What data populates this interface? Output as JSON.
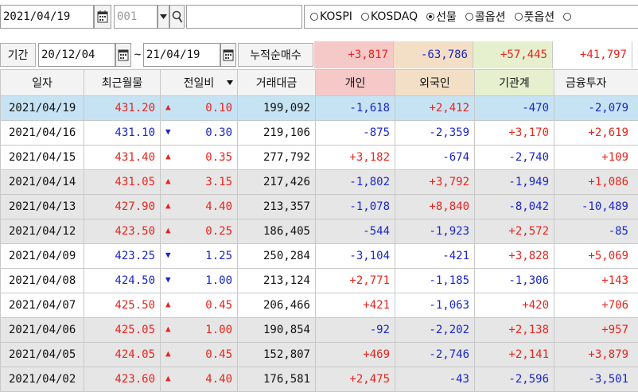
{
  "toolbar": {
    "date": "2021/04/19",
    "code": "001",
    "search_value": "",
    "markets": [
      {
        "label": "KOSPI",
        "selected": false
      },
      {
        "label": "KOSDAQ",
        "selected": false
      },
      {
        "label": "선물",
        "selected": true
      },
      {
        "label": "콜옵션",
        "selected": false
      },
      {
        "label": "풋옵션",
        "selected": false
      },
      {
        "label": "",
        "selected": false
      }
    ]
  },
  "period": {
    "label": "기간",
    "start": "20/12/04",
    "separator": "~",
    "end": "21/04/19",
    "cumulative_label": "누적순매수"
  },
  "summary": [
    "+3,817",
    "-63,786",
    "+57,445",
    "+41,797"
  ],
  "colors": {
    "up": "#e8241c",
    "down": "#1a26c8",
    "header_individual": "#f6c9c9",
    "header_foreign": "#f3dfc6",
    "header_institution": "#e6f0cf",
    "selected_row": "#c6e3f3",
    "shaded_row": "#e6e6e6"
  },
  "table": {
    "columns": [
      "일자",
      "최근월물",
      "전일비",
      "거래대금",
      "개인",
      "외국인",
      "기관계",
      "금융투자"
    ],
    "rows": [
      {
        "date": "2021/04/19",
        "price": "431.20",
        "dir": "up",
        "change": "0.10",
        "amount": "199,092",
        "individual": "-1,618",
        "foreign": "+2,412",
        "institution": "-470",
        "financial": "-2,079",
        "shade": "selected"
      },
      {
        "date": "2021/04/16",
        "price": "431.10",
        "dir": "down",
        "change": "0.30",
        "amount": "219,106",
        "individual": "-875",
        "foreign": "-2,359",
        "institution": "+3,170",
        "financial": "+2,619",
        "shade": "white"
      },
      {
        "date": "2021/04/15",
        "price": "431.40",
        "dir": "up",
        "change": "0.35",
        "amount": "277,792",
        "individual": "+3,182",
        "foreign": "-674",
        "institution": "-2,740",
        "financial": "+109",
        "shade": "white"
      },
      {
        "date": "2021/04/14",
        "price": "431.05",
        "dir": "up",
        "change": "3.15",
        "amount": "217,426",
        "individual": "-1,802",
        "foreign": "+3,792",
        "institution": "-1,949",
        "financial": "+1,086",
        "shade": "grey"
      },
      {
        "date": "2021/04/13",
        "price": "427.90",
        "dir": "up",
        "change": "4.40",
        "amount": "213,357",
        "individual": "-1,078",
        "foreign": "+8,840",
        "institution": "-8,042",
        "financial": "-10,489",
        "shade": "grey"
      },
      {
        "date": "2021/04/12",
        "price": "423.50",
        "dir": "up",
        "change": "0.25",
        "amount": "186,405",
        "individual": "-544",
        "foreign": "-1,923",
        "institution": "+2,572",
        "financial": "-85",
        "shade": "grey"
      },
      {
        "date": "2021/04/09",
        "price": "423.25",
        "dir": "down",
        "change": "1.25",
        "amount": "250,284",
        "individual": "-3,104",
        "foreign": "-421",
        "institution": "+3,828",
        "financial": "+5,069",
        "shade": "white"
      },
      {
        "date": "2021/04/08",
        "price": "424.50",
        "dir": "down",
        "change": "1.00",
        "amount": "213,124",
        "individual": "+2,771",
        "foreign": "-1,185",
        "institution": "-1,306",
        "financial": "+143",
        "shade": "white"
      },
      {
        "date": "2021/04/07",
        "price": "425.50",
        "dir": "up",
        "change": "0.45",
        "amount": "206,466",
        "individual": "+421",
        "foreign": "-1,063",
        "institution": "+420",
        "financial": "+706",
        "shade": "white"
      },
      {
        "date": "2021/04/06",
        "price": "425.05",
        "dir": "up",
        "change": "1.00",
        "amount": "190,854",
        "individual": "-92",
        "foreign": "-2,202",
        "institution": "+2,138",
        "financial": "+957",
        "shade": "grey"
      },
      {
        "date": "2021/04/05",
        "price": "424.05",
        "dir": "up",
        "change": "0.45",
        "amount": "152,807",
        "individual": "+469",
        "foreign": "-2,746",
        "institution": "+2,141",
        "financial": "+3,879",
        "shade": "grey"
      },
      {
        "date": "2021/04/02",
        "price": "423.60",
        "dir": "up",
        "change": "4.40",
        "amount": "176,581",
        "individual": "+2,475",
        "foreign": "-43",
        "institution": "-2,596",
        "financial": "-3,501",
        "shade": "grey"
      }
    ]
  }
}
